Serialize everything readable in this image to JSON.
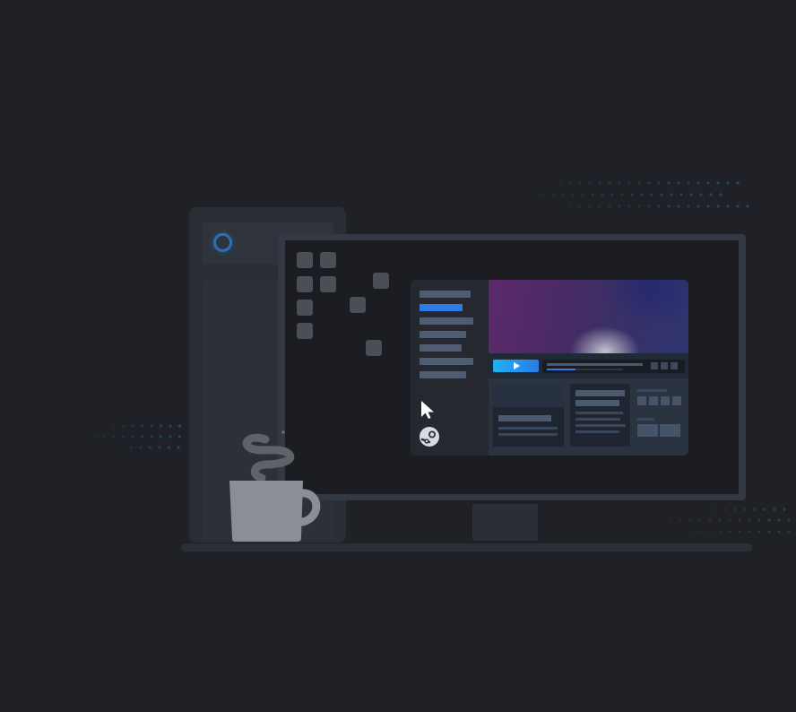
{
  "scene": {
    "description_free": true
  },
  "colors": {
    "background": "#1f2126",
    "accent_blue": "#2f79e8",
    "play_gradient_start": "#23b0f2",
    "play_gradient_end": "#2b7ce6",
    "power_ring": "#2e6fb3",
    "mug": "#8a8e95"
  },
  "icons": {
    "play": "play-triangle-icon",
    "cursor": "mouse-pointer-icon",
    "logo": "steam-logo-icon",
    "power": "power-ring-icon",
    "mug": "coffee-mug-icon"
  },
  "player": {
    "progress": 0.38
  }
}
